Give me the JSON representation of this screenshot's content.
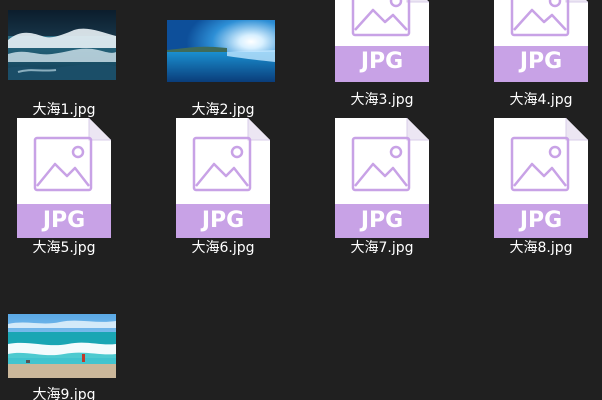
{
  "window": {
    "view": "large-icons",
    "background": "#202020"
  },
  "colors": {
    "jpg_band": "#c8a2e6",
    "jpg_line": "#c8a2e6",
    "page_white": "#ffffff",
    "label_text": "#ffffff"
  },
  "files": [
    {
      "name": "大海1.jpg",
      "thumbnail": "photo-stormy-sea"
    },
    {
      "name": "大海2.jpg",
      "thumbnail": "photo-sunlit-sea"
    },
    {
      "name": "大海3.jpg",
      "thumbnail": "jpg-file-icon",
      "badge": "JPG"
    },
    {
      "name": "大海4.jpg",
      "thumbnail": "jpg-file-icon",
      "badge": "JPG"
    },
    {
      "name": "大海5.jpg",
      "thumbnail": "jpg-file-icon",
      "badge": "JPG"
    },
    {
      "name": "大海6.jpg",
      "thumbnail": "jpg-file-icon",
      "badge": "JPG"
    },
    {
      "name": "大海7.jpg",
      "thumbnail": "jpg-file-icon",
      "badge": "JPG"
    },
    {
      "name": "大海8.jpg",
      "thumbnail": "jpg-file-icon",
      "badge": "JPG"
    },
    {
      "name": "大海9.jpg",
      "thumbnail": "photo-beach-waves"
    }
  ]
}
